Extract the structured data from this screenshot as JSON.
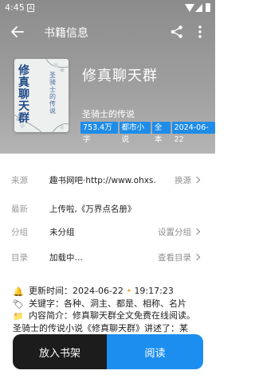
{
  "status_bar": {
    "time": "4:45",
    "sim_badge": "A"
  },
  "app_bar": {
    "title": "书籍信息"
  },
  "book": {
    "title": "修真聊天群",
    "author": "圣骑士的传说",
    "cover_title": "修真聊天群",
    "cover_author": "圣骑士的传说",
    "tags": [
      "753.4万字",
      "都市小说",
      "全本",
      "2024-06-22"
    ]
  },
  "info_rows": [
    {
      "label": "来源",
      "value": "趣书网吧·http://www.ohxs.…",
      "action": "换源"
    },
    {
      "label": "最新",
      "value": "上传啦,《万界点名册》",
      "action": ""
    },
    {
      "label": "分组",
      "value": "未分组",
      "action": "设置分组"
    },
    {
      "label": "目录",
      "value": "加载中…",
      "action": "查看目录"
    }
  ],
  "intro": {
    "update_label": "更新时间：",
    "update_date": "2024-06-22",
    "update_time": "19:17:23",
    "keywords": "关键字：各种、洞主、都是、相称、名片",
    "summary": "内容简介：修真聊天群全文免费在线阅读。",
    "summary2": "圣骑士的传说小说《修真聊天群》讲述了：某"
  },
  "buttons": {
    "add_shelf": "放入书架",
    "read": "阅读"
  },
  "colors": {
    "accent": "#1b8ef0",
    "dark": "#1c1c1c",
    "header": "#9a9a9a"
  }
}
